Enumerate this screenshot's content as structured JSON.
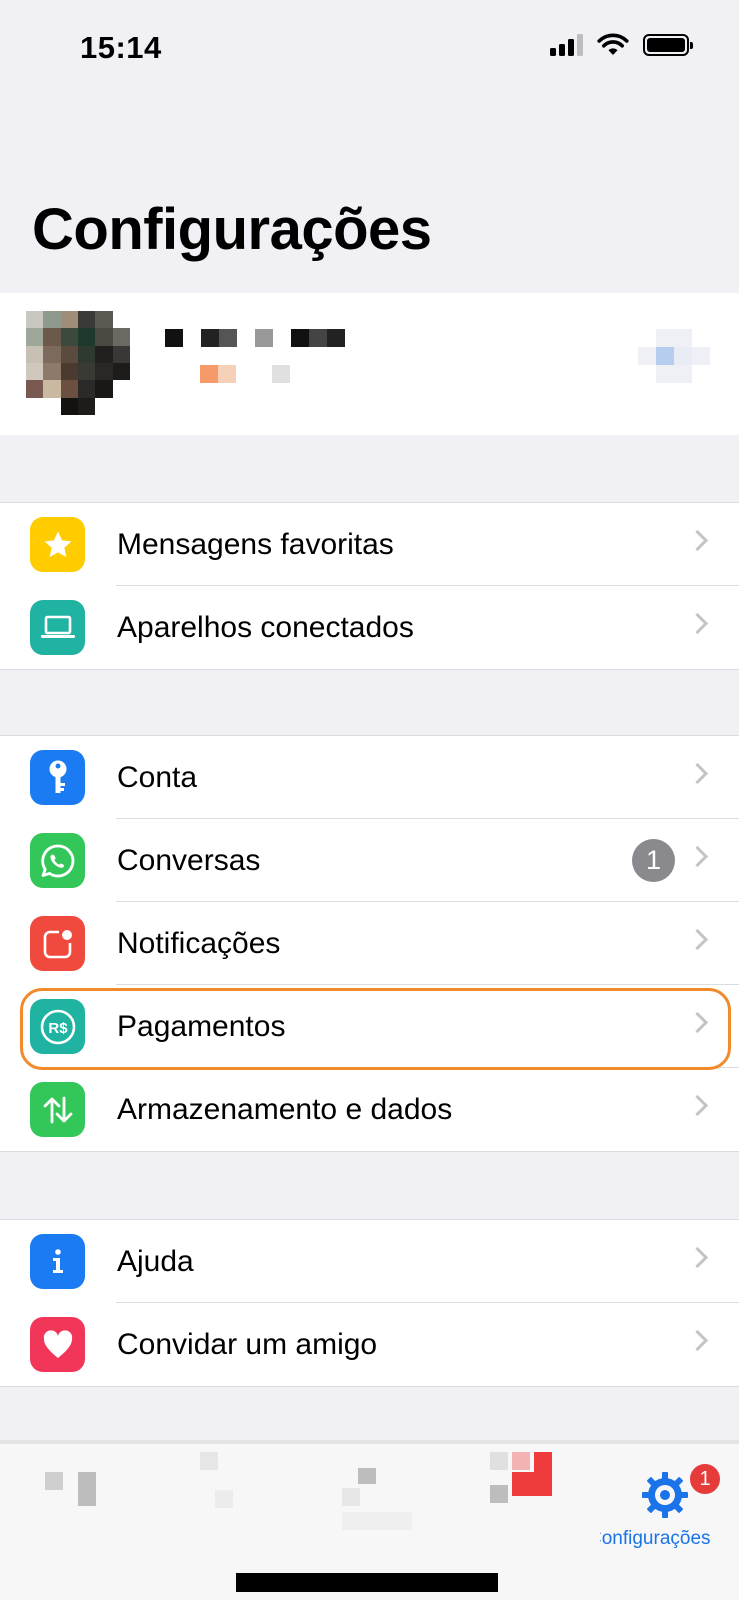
{
  "status_bar": {
    "time": "15:14"
  },
  "page_title": "Configurações",
  "groups": [
    {
      "items": [
        {
          "label": "Mensagens favoritas",
          "icon": "star-icon",
          "color": "#ffcc00"
        },
        {
          "label": "Aparelhos conectados",
          "icon": "laptop-icon",
          "color": "#20b3a2"
        }
      ]
    },
    {
      "items": [
        {
          "label": "Conta",
          "icon": "key-icon",
          "color": "#1a7bf2"
        },
        {
          "label": "Conversas",
          "icon": "whatsapp-icon",
          "color": "#33c759",
          "badge": "1"
        },
        {
          "label": "Notificações",
          "icon": "notification-icon",
          "color": "#f0493e"
        },
        {
          "label": "Pagamentos",
          "icon": "payment-icon",
          "color": "#20b3a2",
          "highlighted": true
        },
        {
          "label": "Armazenamento e dados",
          "icon": "arrows-icon",
          "color": "#33c759"
        }
      ]
    },
    {
      "items": [
        {
          "label": "Ajuda",
          "icon": "info-icon",
          "color": "#1a7bf2"
        },
        {
          "label": "Convidar um amigo",
          "icon": "heart-icon",
          "color": "#f2365a"
        }
      ]
    }
  ],
  "tab_bar": {
    "settings_label": "Configurações",
    "settings_badge": "1",
    "accent_color": "#1a73e8"
  }
}
